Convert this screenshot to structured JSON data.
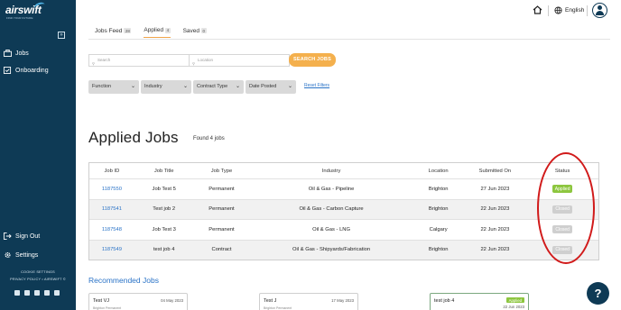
{
  "brand": {
    "name": "airswift",
    "tagline": "FIND YOUR FUTURE"
  },
  "sidebar": {
    "items": [
      {
        "label": "Jobs",
        "icon": "briefcase-icon"
      },
      {
        "label": "Onboarding",
        "icon": "clipboard-icon"
      }
    ],
    "bottom_items": [
      {
        "label": "Sign Out",
        "icon": "sign-out-icon"
      },
      {
        "label": "Settings",
        "icon": "gear-icon"
      }
    ],
    "footer_links": [
      "COOKIE SETTINGS",
      "PRIVACY POLICY • AIRSWIFT ©"
    ],
    "social_icons": [
      "facebook-icon",
      "linkedin-icon",
      "youtube-icon",
      "twitter-icon",
      "instagram-icon"
    ]
  },
  "topbar": {
    "language": "English"
  },
  "tabs": [
    {
      "label": "Jobs Feed",
      "count": "28",
      "active": false
    },
    {
      "label": "Applied",
      "count": "4",
      "active": true
    },
    {
      "label": "Saved",
      "count": "0",
      "active": false
    }
  ],
  "search": {
    "keyword_placeholder": "Search",
    "location_placeholder": "Location",
    "button_label": "SEARCH JOBS"
  },
  "filters": {
    "items": [
      "Function",
      "Industry",
      "Contract Type",
      "Date Posted"
    ],
    "reset_label": "Reset Filters"
  },
  "applied": {
    "title": "Applied Jobs",
    "found": "Found 4 jobs",
    "columns": [
      "Job ID",
      "Job Title",
      "Job Type",
      "Industry",
      "Location",
      "Submitted On",
      "Status"
    ],
    "rows": [
      {
        "id": "1187550",
        "title": "Job Test 5",
        "type": "Permanent",
        "industry": "Oil & Gas - Pipeline",
        "location": "Brighton",
        "submitted": "27 Jun 2023",
        "status": "Applied"
      },
      {
        "id": "1187541",
        "title": "Test job 2",
        "type": "Permanent",
        "industry": "Oil & Gas - Carbon Capture",
        "location": "Brighton",
        "submitted": "22 Jun 2023",
        "status": "Closed"
      },
      {
        "id": "1187548",
        "title": "Job Test 3",
        "type": "Permanent",
        "industry": "Oil & Gas - LNG",
        "location": "Calgary",
        "submitted": "22 Jun 2023",
        "status": "Closed"
      },
      {
        "id": "1187549",
        "title": "test job 4",
        "type": "Contract",
        "industry": "Oil & Gas - Shipyards/Fabrication",
        "location": "Brighton",
        "submitted": "22 Jun 2023",
        "status": "Closed"
      }
    ],
    "status_colors": {
      "Applied": "#8dc63f",
      "Closed": "#cfcfcf"
    }
  },
  "recommended": {
    "title": "Recommended Jobs",
    "cards": [
      {
        "title": "Test VJ",
        "date": "04 May 2023",
        "meta": "Brighton  Permanent",
        "badge": ""
      },
      {
        "title": "Test J",
        "date": "17 May 2023",
        "meta": "Brighton  Permanent",
        "badge": ""
      },
      {
        "title": "test job 4",
        "date": "22 Jun 2023",
        "meta": "",
        "badge": "Applied"
      }
    ]
  },
  "help_label": "?",
  "colors": {
    "sidebar": "#0e3a55",
    "accent": "#f4b04d",
    "link": "#2a73c7",
    "highlight_circle": "#d11a1a"
  }
}
